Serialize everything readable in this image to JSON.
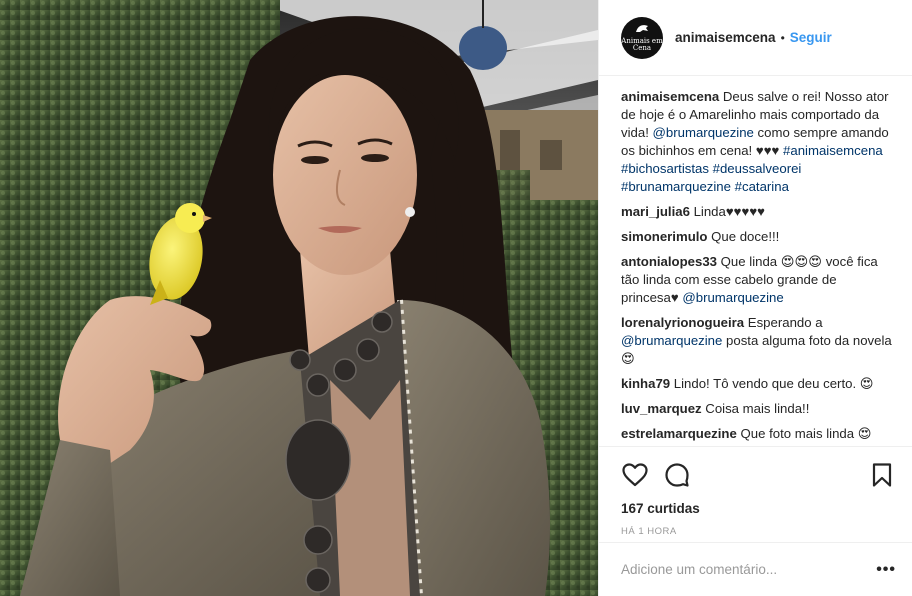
{
  "header": {
    "avatar_text": "Animais em Cena",
    "username": "animaisemcena",
    "separator": "•",
    "follow_label": "Seguir"
  },
  "caption": {
    "user": "animaisemcena",
    "text_1": " Deus salve o rei! Nosso ator de hoje é o Amarelinho mais comportado da vida! ",
    "mention": "@brumarquezine",
    "text_2": " como sempre amando os bichinhos em cena! ♥♥♥ ",
    "tags": [
      "#animaisemcena",
      "#bichosartistas",
      "#deussalveorei",
      "#brunamarquezine",
      "#catarina"
    ]
  },
  "comments": [
    {
      "user": "mari_julia6",
      "text": " Linda♥♥♥♥♥"
    },
    {
      "user": "simonerimulo",
      "text": " Que doce!!!"
    },
    {
      "user": "antonialopes33",
      "text": " Que linda 😍😍😍 você fica tão linda com esse cabelo grande de princesa♥ ",
      "mention": "@brumarquezine"
    },
    {
      "user": "lorenalyrionogueira",
      "text": " Esperando a ",
      "mention": "@brumarquezine",
      "text_after": " posta alguma foto da novela 😍"
    },
    {
      "user": "kinha79",
      "text": " Lindo! Tô vendo que deu certo. 😍"
    },
    {
      "user": "luv_marquez",
      "text": " Coisa mais linda!!"
    },
    {
      "user": "estrelamarquezine",
      "text": " Que foto mais linda 😍"
    }
  ],
  "actions": {
    "like_icon": "heart-icon",
    "comment_icon": "comment-icon",
    "save_icon": "bookmark-icon",
    "likes": "167 curtidas",
    "time": "HÁ 1 HORA"
  },
  "add_comment": {
    "placeholder": "Adicione um comentário...",
    "more_label": "•••"
  },
  "colors": {
    "link": "#003569",
    "follow": "#3897f0",
    "text": "#262626",
    "muted": "#999999",
    "border": "#efefef"
  }
}
